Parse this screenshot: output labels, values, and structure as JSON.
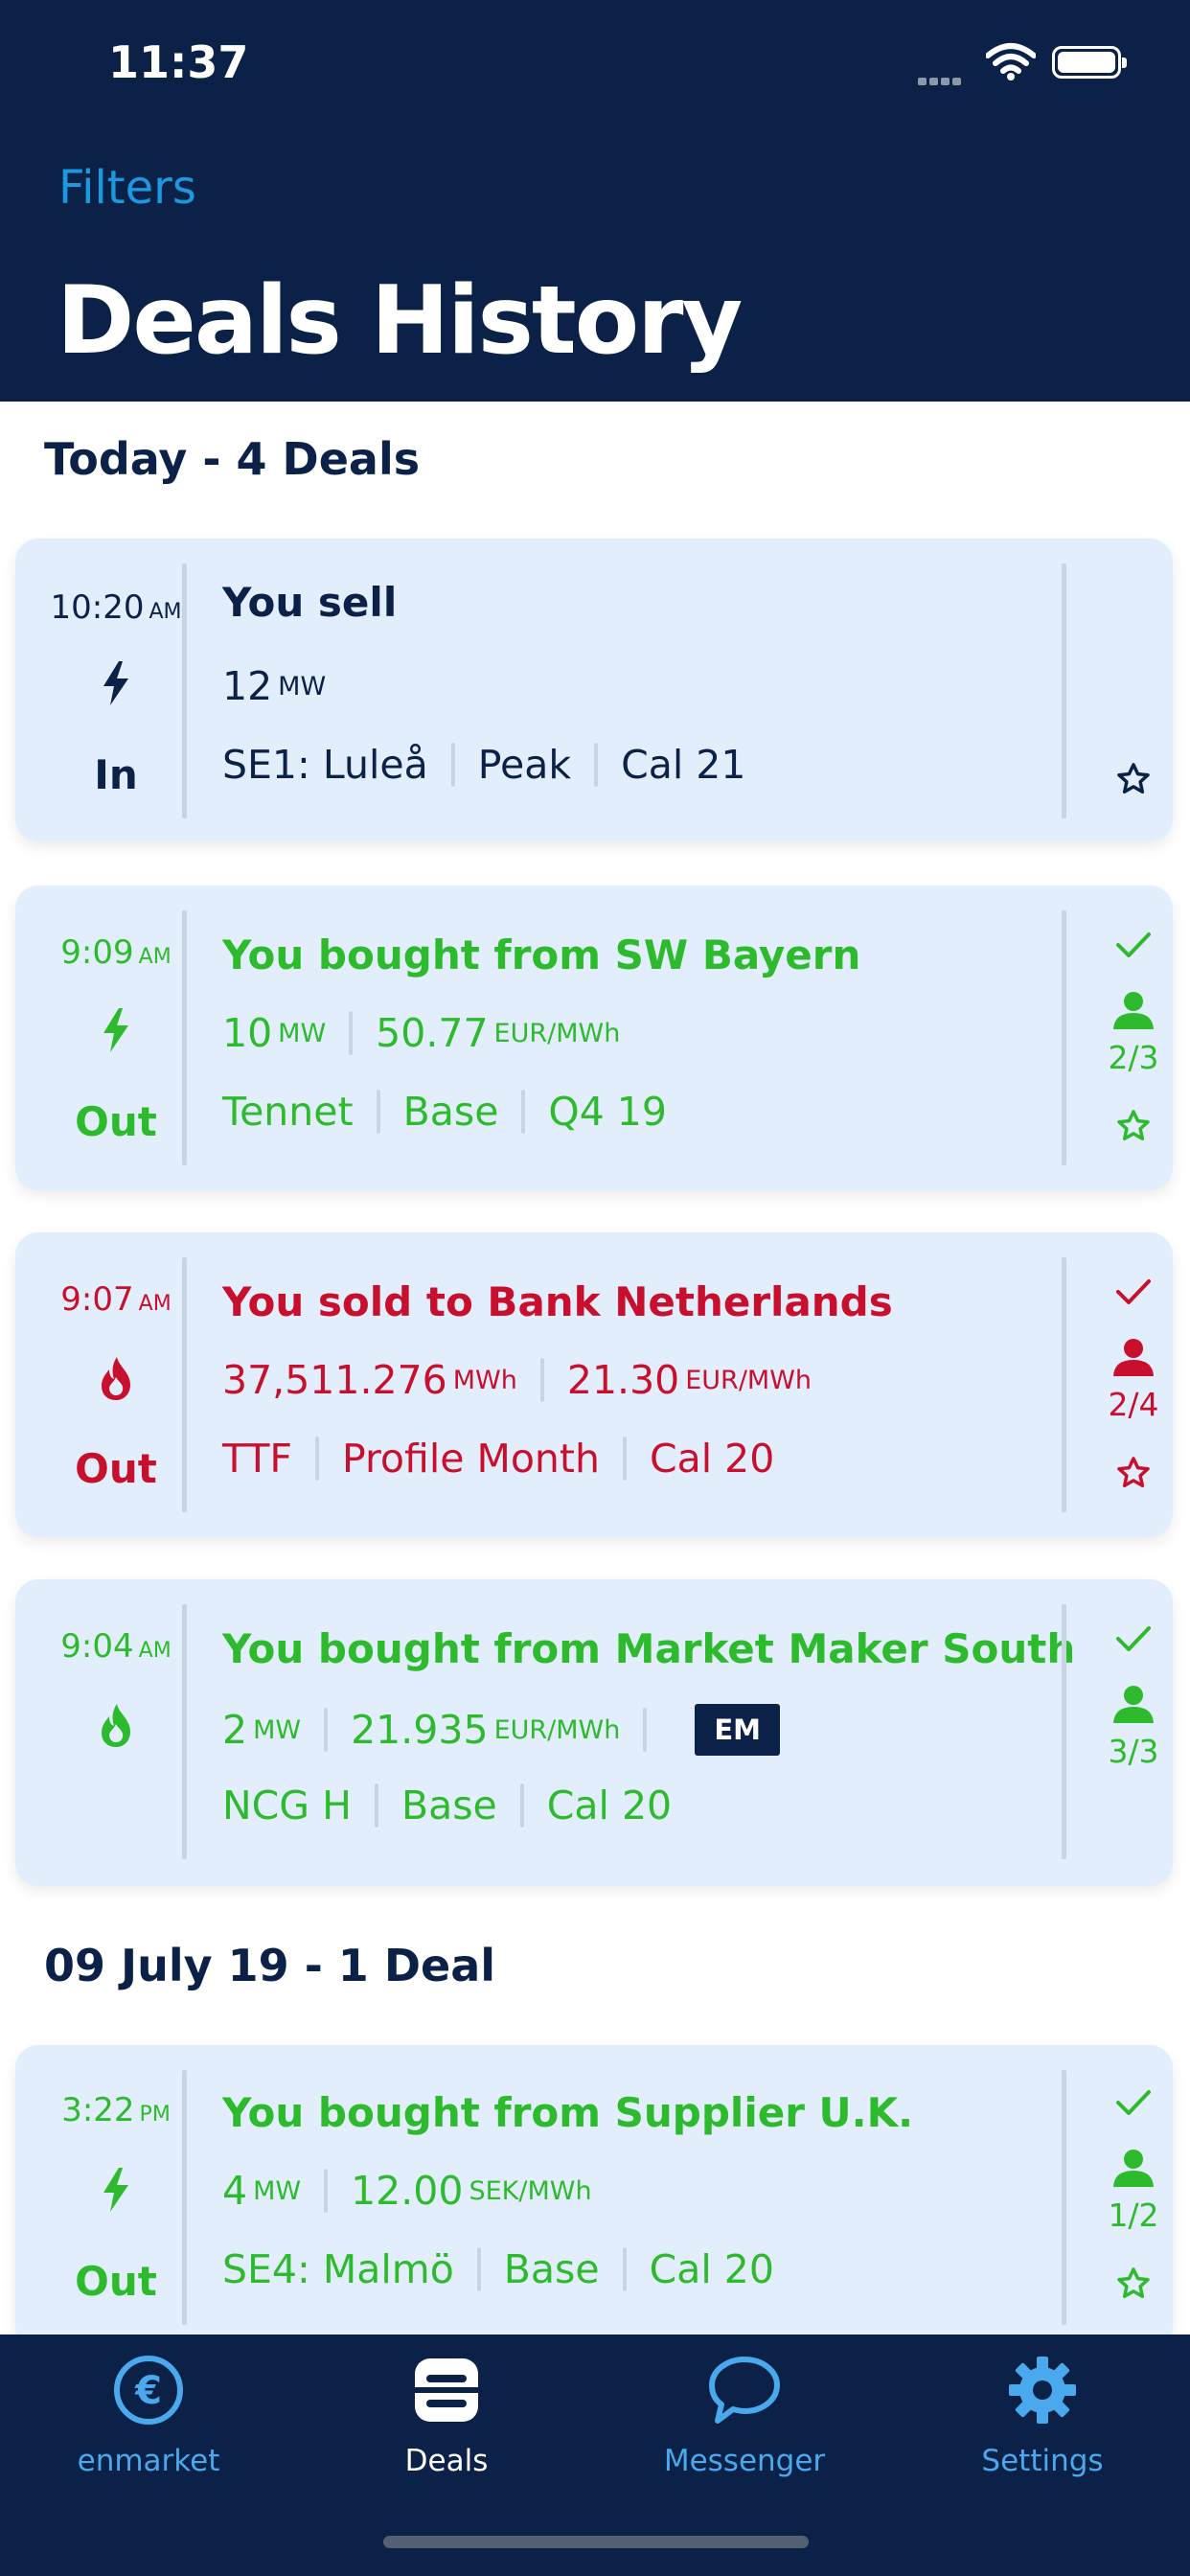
{
  "status_bar": {
    "time": "11:37"
  },
  "nav": {
    "filters_label": "Filters",
    "title": "Deals History"
  },
  "sections": [
    {
      "label": "Today - 4 Deals"
    },
    {
      "label": "09 July 19 - 1 Deal"
    }
  ],
  "deals": [
    {
      "time": "10:20",
      "meridiem": "AM",
      "direction": "In",
      "product_icon": "bolt-icon",
      "status": "neutral",
      "title": "You sell",
      "quantity": "12",
      "quantity_unit": "MW",
      "area": "SE1: Luleå",
      "profile": "Peak",
      "period": "Cal 21",
      "starred": false
    },
    {
      "time": "9:09",
      "meridiem": "AM",
      "direction": "Out",
      "product_icon": "bolt-icon",
      "status": "bought",
      "title": "You bought from SW Bayern",
      "quantity": "10",
      "quantity_unit": "MW",
      "price": "50.77",
      "price_unit": "EUR/MWh",
      "area": "Tennet",
      "profile": "Base",
      "period": "Q4 19",
      "approvals": "2/3",
      "starred": false
    },
    {
      "time": "9:07",
      "meridiem": "AM",
      "direction": "Out",
      "product_icon": "flame-icon",
      "status": "sold",
      "title": "You sold to Bank Netherlands",
      "quantity": "37,511.276",
      "quantity_unit": "MWh",
      "price": "21.30",
      "price_unit": "EUR/MWh",
      "area": "TTF",
      "profile": "Profile Month",
      "period": "Cal 20",
      "approvals": "2/4",
      "starred": false
    },
    {
      "time": "9:04",
      "meridiem": "AM",
      "product_icon": "flame-icon",
      "status": "bought",
      "title": "You bought from Market Maker South",
      "quantity": "2",
      "quantity_unit": "MW",
      "price": "21.935",
      "price_unit": "EUR/MWh",
      "badge": "EM",
      "area": "NCG H",
      "profile": "Base",
      "period": "Cal 20",
      "approvals": "3/3"
    },
    {
      "time": "3:22",
      "meridiem": "PM",
      "direction": "Out",
      "product_icon": "bolt-icon",
      "status": "bought",
      "title": "You bought from Supplier U.K.",
      "quantity": "4",
      "quantity_unit": "MW",
      "price": "12.00",
      "price_unit": "SEK/MWh",
      "area": "SE4: Malmö",
      "profile": "Base",
      "period": "Cal 20",
      "approvals": "1/2",
      "starred": false
    }
  ],
  "tabs": [
    {
      "label": "enmarket",
      "icon": "euro-icon",
      "active": false
    },
    {
      "label": "Deals",
      "icon": "deals-icon",
      "active": true
    },
    {
      "label": "Messenger",
      "icon": "chat-bubble-icon",
      "active": false
    },
    {
      "label": "Settings",
      "icon": "gear-icon",
      "active": false
    }
  ],
  "colors": {
    "navy": "#0c2147",
    "accent_blue": "#1b98e0",
    "tab_inactive": "#4aa8ec",
    "bought_green": "#2dbb2d",
    "sold_red": "#c8102e",
    "card_bg": "#e2eefb"
  }
}
